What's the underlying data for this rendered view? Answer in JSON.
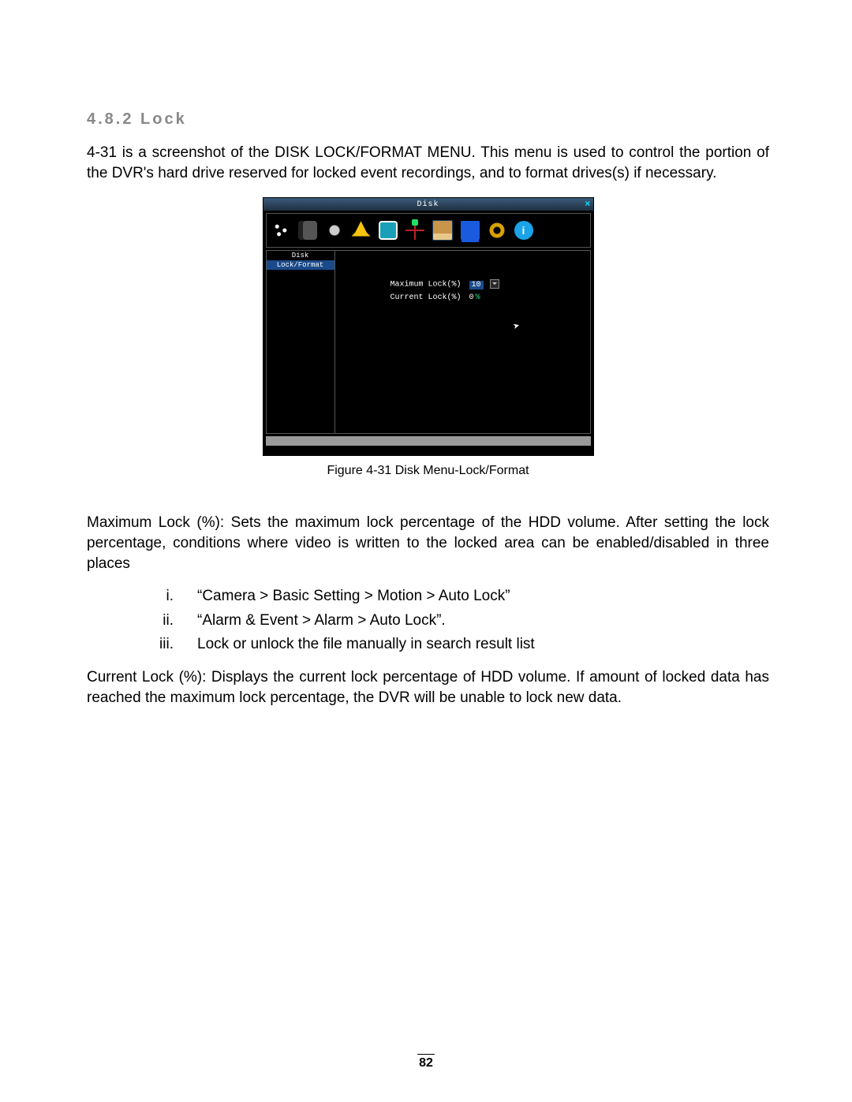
{
  "heading": "4.8.2   Lock",
  "intro": "4-31 is a screenshot of the DISK LOCK/FORMAT MENU. This menu is used to control the portion of the DVR's hard drive reserved for locked event recordings, and to format drives(s) if necessary.",
  "figure_caption": "Figure 4-31 Disk Menu-Lock/Format",
  "screenshot": {
    "title": "Disk",
    "close": "×",
    "sidebar": {
      "item1": "Disk",
      "item2": "Lock/Format"
    },
    "fields": {
      "max_label": "Maximum Lock(%)",
      "max_value": "10",
      "cur_label": "Current Lock(%)",
      "cur_value": "0",
      "cur_unit": "%"
    }
  },
  "para_max": "Maximum Lock (%): Sets the maximum lock percentage of the HDD volume. After setting the lock percentage, conditions where video is written to the locked area can be enabled/disabled in three places",
  "list": {
    "i": "“Camera > Basic Setting > Motion > Auto Lock”",
    "ii": "“Alarm & Event > Alarm > Auto Lock”.",
    "iii": "Lock or unlock the file manually in search result list"
  },
  "para_cur": "Current Lock (%): Displays the current lock percentage of HDD volume. If amount of locked data has reached the maximum lock percentage, the DVR will be unable to lock new data.",
  "page_number": "82"
}
